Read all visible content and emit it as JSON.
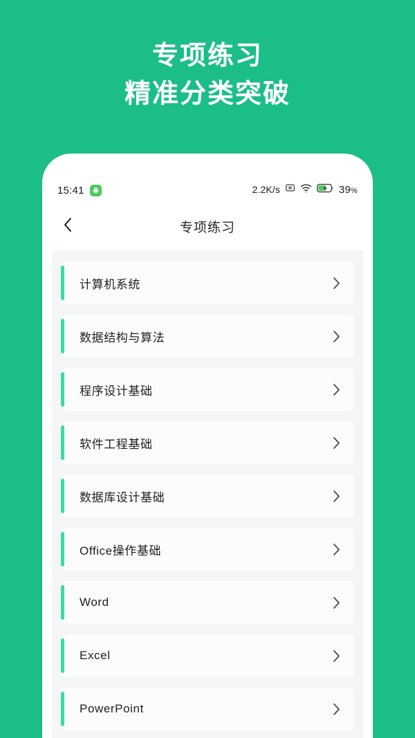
{
  "promo": {
    "line1": "专项练习",
    "line2": "精准分类突破",
    "text_color": "#FFFFFF",
    "background_color": "#1BBE86"
  },
  "statusbar": {
    "time": "15:41",
    "app_badge_icon": "android-app-icon",
    "network_speed": "2.2K/s",
    "signal_off_icon": "signal-x-icon",
    "wifi_icon": "wifi-icon",
    "battery_icon": "battery-charging-icon",
    "battery_percent": "39",
    "percent_unit": "%"
  },
  "navbar": {
    "back_icon": "chevron-left-icon",
    "title": "专项练习"
  },
  "list": {
    "background_color": "#F4F5F6",
    "card_color": "#FCFCFC",
    "accent_color": "#3BDC9B",
    "chevron_icon": "chevron-right-icon",
    "items": [
      {
        "label": "计算机系统"
      },
      {
        "label": "数据结构与算法"
      },
      {
        "label": "程序设计基础"
      },
      {
        "label": "软件工程基础"
      },
      {
        "label": "数据库设计基础"
      },
      {
        "label": "Office操作基础"
      },
      {
        "label": "Word"
      },
      {
        "label": "Excel"
      },
      {
        "label": "PowerPoint"
      }
    ]
  }
}
